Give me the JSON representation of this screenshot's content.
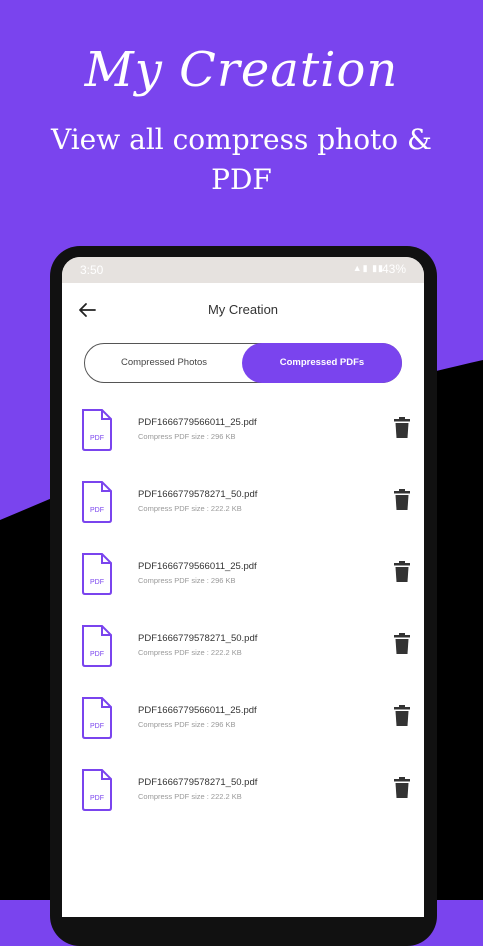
{
  "promo": {
    "title": "My Creation",
    "subtitle": "View all compress photo & PDF"
  },
  "status_bar": {
    "time": "3:50",
    "battery": "43%"
  },
  "app_bar": {
    "title": "My Creation"
  },
  "tabs": [
    {
      "label": "Compressed Photos",
      "selected": false
    },
    {
      "label": "Compressed PDFs",
      "selected": true
    }
  ],
  "files": [
    {
      "name": "PDF1666779566011_25.pdf",
      "size": "Compress PDF size : 296 KB"
    },
    {
      "name": "PDF1666779578271_50.pdf",
      "size": "Compress PDF size : 222.2 KB"
    },
    {
      "name": "PDF1666779566011_25.pdf",
      "size": "Compress PDF size : 296 KB"
    },
    {
      "name": "PDF1666779578271_50.pdf",
      "size": "Compress PDF size : 222.2 KB"
    },
    {
      "name": "PDF1666779566011_25.pdf",
      "size": "Compress PDF size : 296 KB"
    },
    {
      "name": "PDF1666779578271_50.pdf",
      "size": "Compress PDF size : 222.2 KB"
    }
  ],
  "file_icon_label": "PDF",
  "colors": {
    "accent": "#7a44ee",
    "background_dark": "#000000"
  }
}
